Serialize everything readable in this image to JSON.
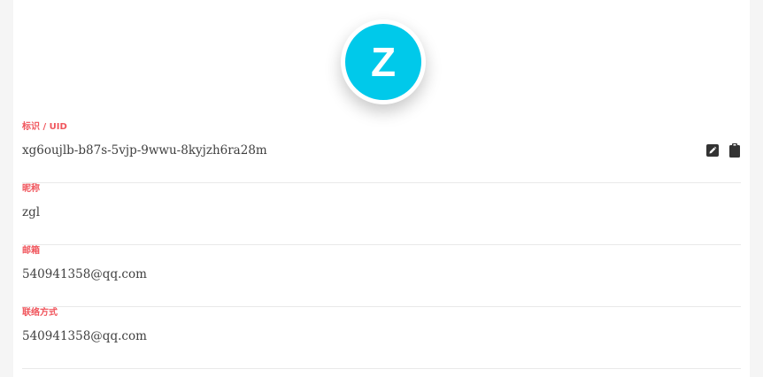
{
  "avatar": {
    "letter": "Z",
    "color": "#00c9ea"
  },
  "fields": [
    {
      "label": "标识 / UID",
      "value": "xg6oujlb-b87s-5vjp-9wwu-8kyjzh6ra28m",
      "icons": [
        "edit-icon",
        "clipboard-icon"
      ]
    },
    {
      "label": "昵称",
      "value": "zgl"
    },
    {
      "label": "邮箱",
      "value": "540941358@qq.com"
    },
    {
      "label": "联络方式",
      "value": "540941358@qq.com"
    }
  ],
  "colors": {
    "label": "#f0555c",
    "value": "#404040",
    "divider": "#e9e9e9"
  }
}
